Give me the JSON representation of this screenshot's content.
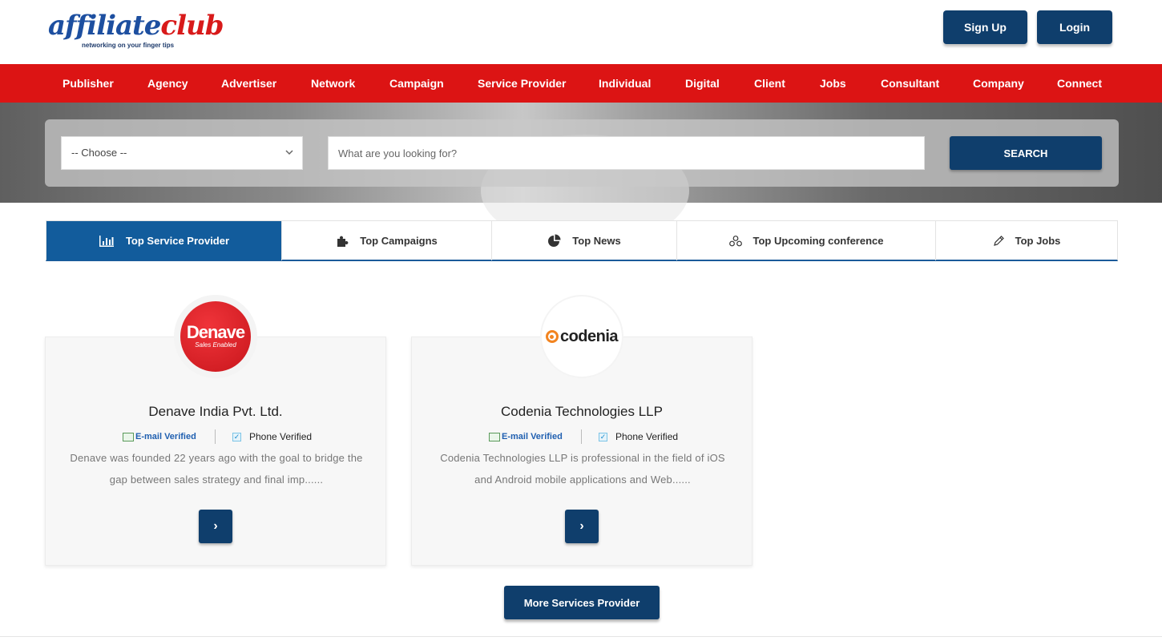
{
  "brand": {
    "logo_part1": "affiliate",
    "logo_part2": "club",
    "tagline": "networking on your finger tips",
    "colors": {
      "primary_blue": "#0f3e6c",
      "nav_red": "#dc1414",
      "tab_active": "#125c9c",
      "logo_blue": "#1d4fa0",
      "logo_red": "#d81a1a"
    }
  },
  "header": {
    "signup_label": "Sign Up",
    "login_label": "Login"
  },
  "nav": {
    "items": [
      "Publisher",
      "Agency",
      "Advertiser",
      "Network",
      "Campaign",
      "Service Provider",
      "Individual",
      "Digital",
      "Client",
      "Jobs",
      "Consultant",
      "Company",
      "Connect"
    ]
  },
  "search": {
    "select_value": "-- Choose --",
    "input_placeholder": "What are you looking for?",
    "button_label": "SEARCH"
  },
  "tabs": [
    {
      "label": "Top Service Provider",
      "icon": "bar-chart-icon",
      "active": true
    },
    {
      "label": "Top Campaigns",
      "icon": "puzzle-icon",
      "active": false
    },
    {
      "label": "Top News",
      "icon": "pie-chart-icon",
      "active": false
    },
    {
      "label": "Top Upcoming conference",
      "icon": "group-icon",
      "active": false
    },
    {
      "label": "Top Jobs",
      "icon": "pencil-icon",
      "active": false
    }
  ],
  "providers": [
    {
      "name": "Denave India Pvt. Ltd.",
      "logo_text": "Denave",
      "logo_sub": "Sales Enabled",
      "email_verified": "E-mail Verified",
      "phone_verified": "Phone Verified",
      "description_line1": "Denave was founded 22 years ago with the goal to bridge the",
      "description_line2": "gap between sales strategy and final imp......"
    },
    {
      "name": "Codenia Technologies LLP",
      "logo_text": "codenia",
      "email_verified": "E-mail Verified",
      "phone_verified": "Phone Verified",
      "description_line1": "Codenia Technologies LLP is professional in the field of iOS",
      "description_line2": "and Android mobile applications and Web......"
    }
  ],
  "more_button_label": "More Services Provider",
  "arrow_glyph": "›"
}
